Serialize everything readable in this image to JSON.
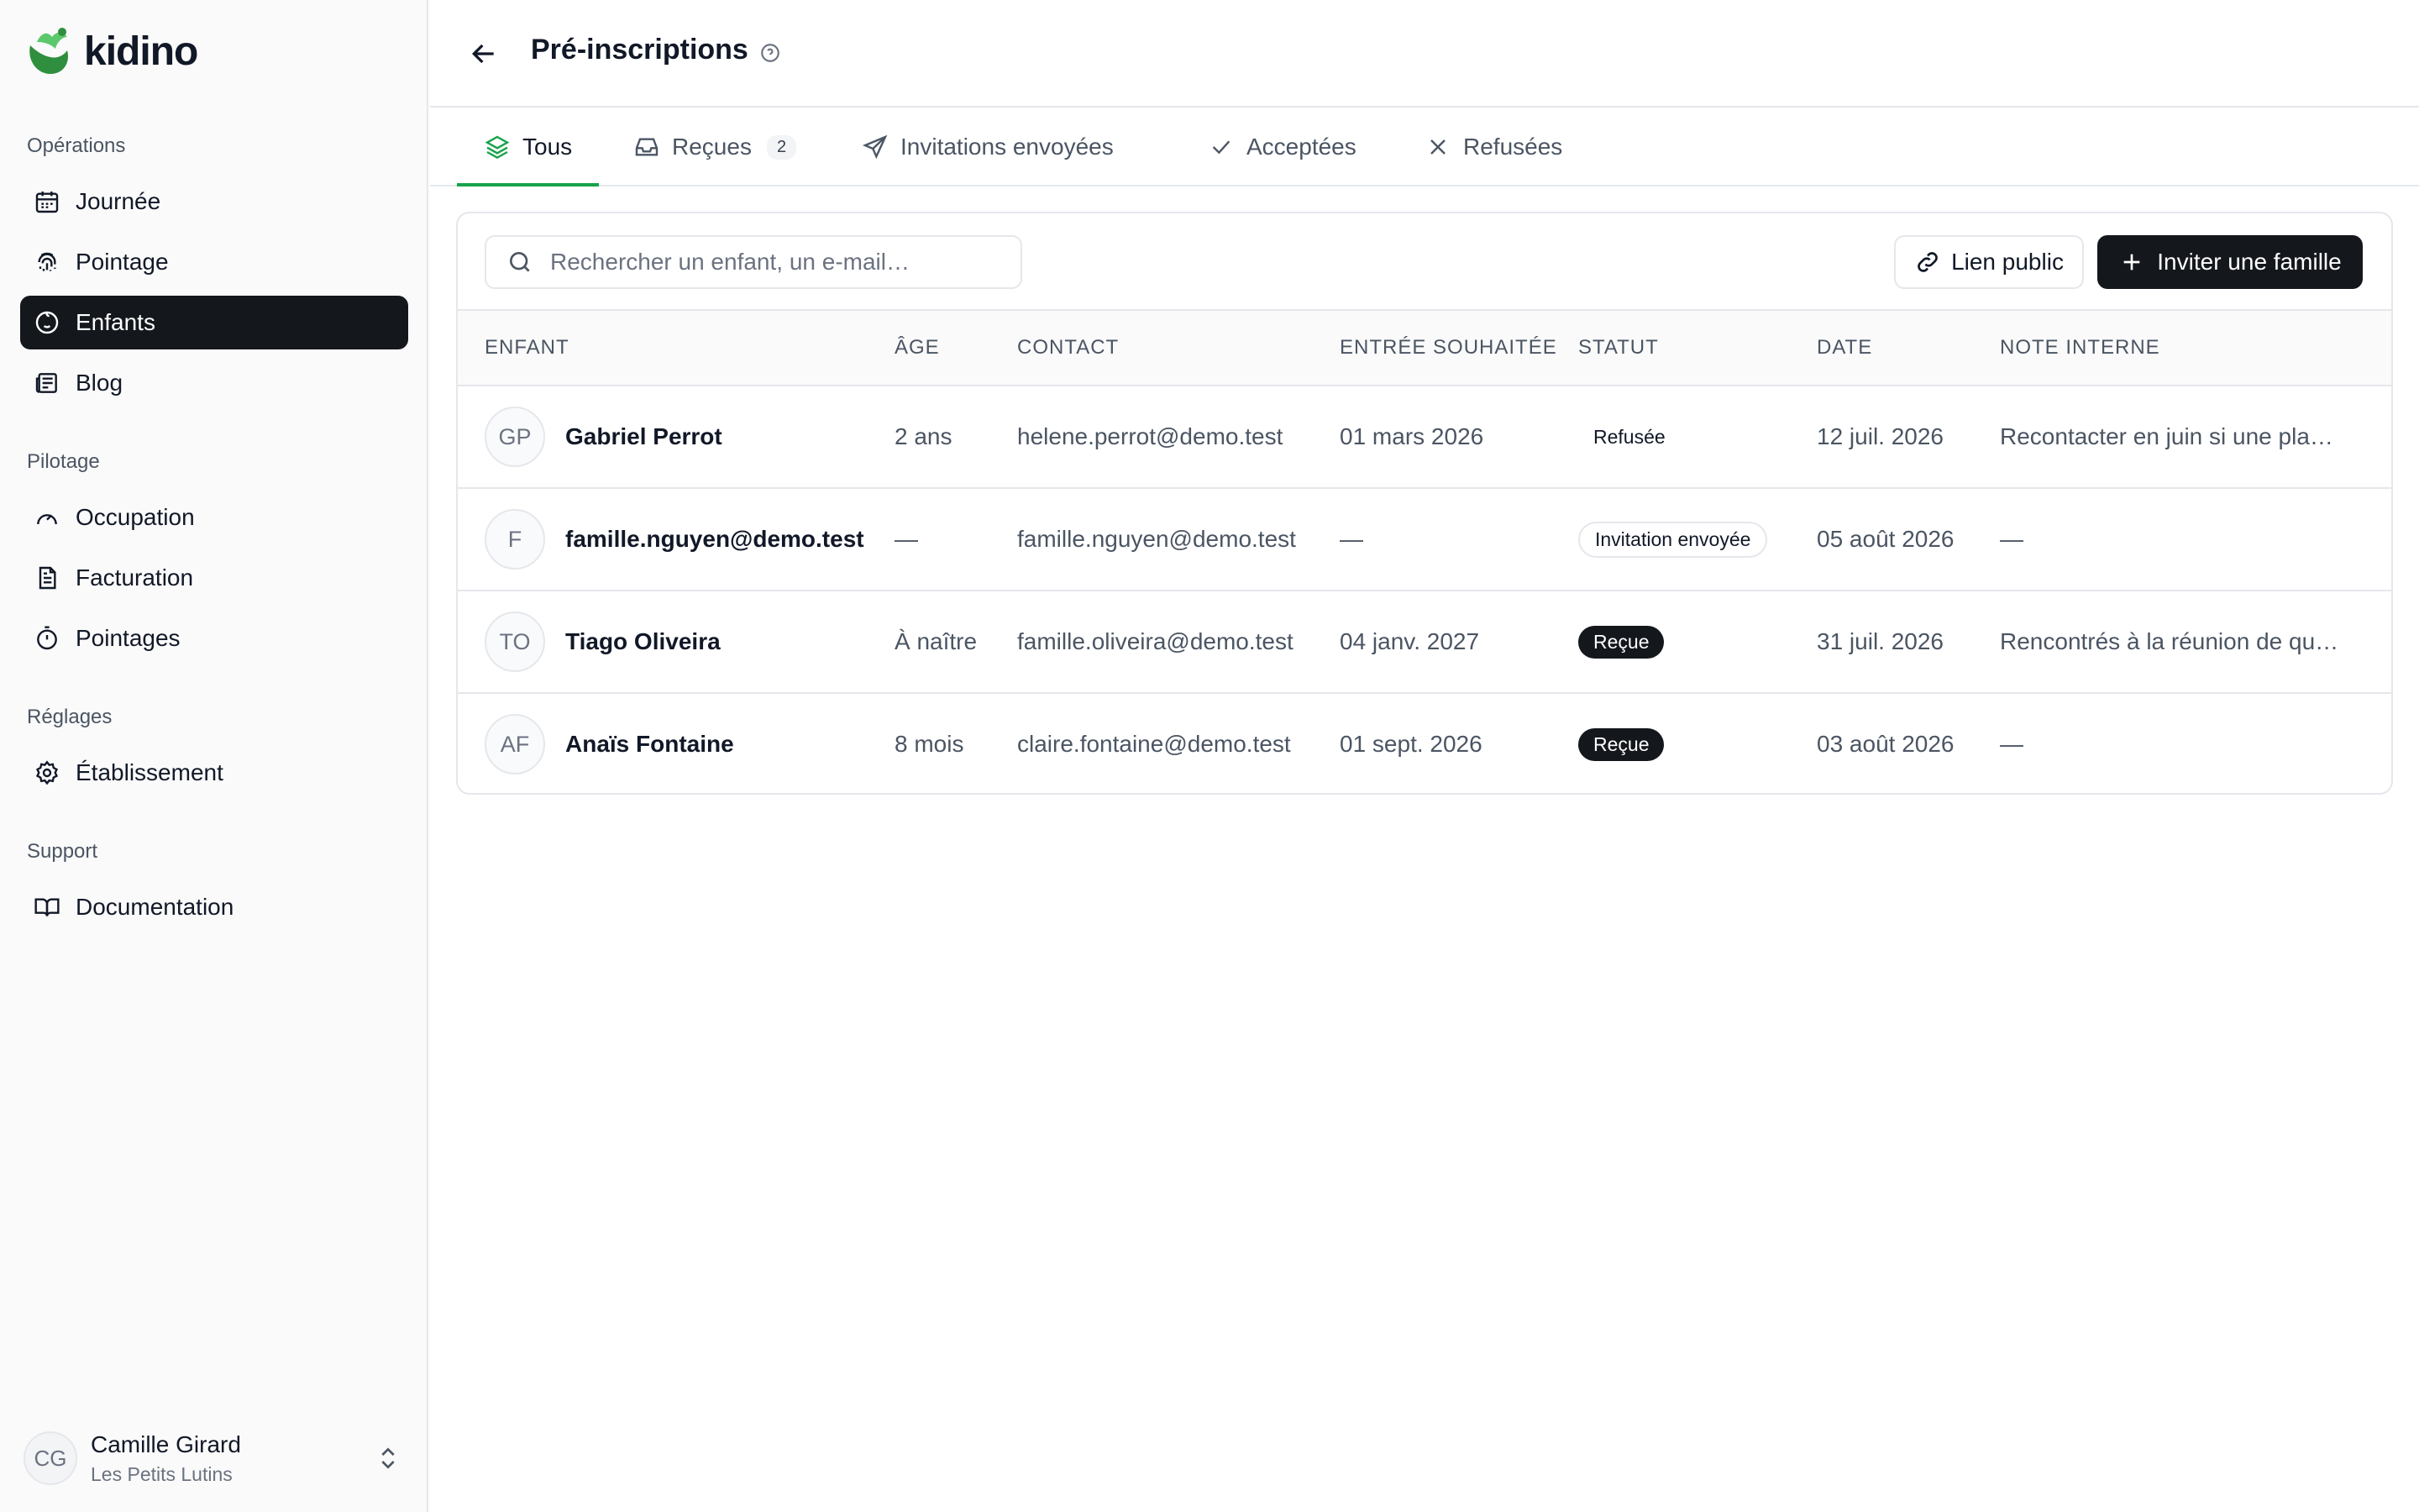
{
  "brand": {
    "name": "kidino"
  },
  "sidebar": {
    "sections": [
      {
        "label": "Opérations"
      },
      {
        "label": "Pilotage"
      },
      {
        "label": "Réglages"
      },
      {
        "label": "Support"
      }
    ],
    "items": [
      {
        "label": "Journée",
        "icon": "calendar-icon"
      },
      {
        "label": "Pointage",
        "icon": "fingerprint-icon"
      },
      {
        "label": "Enfants",
        "icon": "baby-icon",
        "active": true
      },
      {
        "label": "Blog",
        "icon": "newspaper-icon"
      },
      {
        "label": "Occupation",
        "icon": "gauge-icon"
      },
      {
        "label": "Facturation",
        "icon": "invoice-icon"
      },
      {
        "label": "Pointages",
        "icon": "timer-icon"
      },
      {
        "label": "Établissement",
        "icon": "gear-icon"
      },
      {
        "label": "Documentation",
        "icon": "book-icon"
      }
    ],
    "user": {
      "initials": "CG",
      "name": "Camille Girard",
      "org": "Les Petits Lutins"
    }
  },
  "header": {
    "title": "Pré-inscriptions"
  },
  "tabs": [
    {
      "label": "Tous",
      "icon": "layers-icon",
      "active": true
    },
    {
      "label": "Reçues",
      "icon": "inbox-icon",
      "badge": "2"
    },
    {
      "label": "Invitations envoyées",
      "icon": "send-icon"
    },
    {
      "label": "Acceptées",
      "icon": "check-icon"
    },
    {
      "label": "Refusées",
      "icon": "x-icon"
    }
  ],
  "toolbar": {
    "search_placeholder": "Rechercher un enfant, un e-mail…",
    "public_link_label": "Lien public",
    "invite_label": "Inviter une famille"
  },
  "table": {
    "columns": [
      "Enfant",
      "Âge",
      "Contact",
      "Entrée souhaitée",
      "Statut",
      "Date",
      "Note interne"
    ],
    "rows": [
      {
        "initials": "GP",
        "name": "Gabriel Perrot",
        "age": "2 ans",
        "contact": "helene.perrot@demo.test",
        "entry": "01 mars 2026",
        "status": "Refusée",
        "date": "12 juil. 2026",
        "note": "Recontacter en juin si une pla…"
      },
      {
        "initials": "F",
        "name": "famille.nguyen@demo.test",
        "age": "—",
        "contact": "famille.nguyen@demo.test",
        "entry": "—",
        "status": "Invitation envoyée",
        "date": "05 août 2026",
        "note": "—"
      },
      {
        "initials": "TO",
        "name": "Tiago Oliveira",
        "age": "À naître",
        "contact": "famille.oliveira@demo.test",
        "entry": "04 janv. 2027",
        "status": "Reçue",
        "date": "31 juil. 2026",
        "note": "Rencontrés à la réunion de qu…"
      },
      {
        "initials": "AF",
        "name": "Anaïs Fontaine",
        "age": "8 mois",
        "contact": "claire.fontaine@demo.test",
        "entry": "01 sept. 2026",
        "status": "Reçue",
        "date": "03 août 2026",
        "note": "—"
      }
    ]
  },
  "colors": {
    "accent": "#16a34a",
    "dark": "#14171c"
  }
}
